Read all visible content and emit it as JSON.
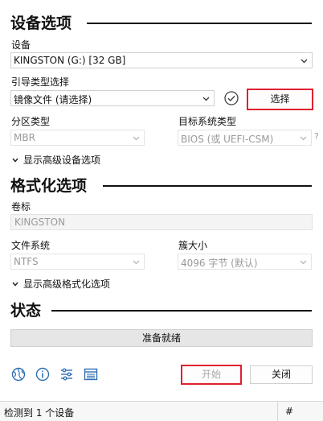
{
  "device_section": {
    "title": "设备选项",
    "device_label": "设备",
    "device_value": "KINGSTON (G:) [32 GB]",
    "boot_label": "引导类型选择",
    "boot_value": "镜像文件 (请选择)",
    "select_button": "选择",
    "partition_label": "分区类型",
    "partition_value": "MBR",
    "target_label": "目标系统类型",
    "target_value": "BIOS (或 UEFI-CSM)",
    "target_help": "?",
    "advanced_toggle": "显示高级设备选项"
  },
  "format_section": {
    "title": "格式化选项",
    "volume_label": "卷标",
    "volume_value": "KINGSTON",
    "fs_label": "文件系统",
    "fs_value": "NTFS",
    "cluster_label": "簇大小",
    "cluster_value": "4096 字节 (默认)",
    "advanced_toggle": "显示高级格式化选项"
  },
  "status_section": {
    "title": "状态",
    "progress_text": "准备就绪",
    "progress_fraction": 0
  },
  "toolbar": {
    "icons": [
      "globe-icon",
      "info-icon",
      "settings-sliders-icon",
      "log-icon"
    ]
  },
  "actions": {
    "start_button": "开始",
    "close_button": "关闭"
  },
  "statusbar": {
    "text": "检测到 1 个设备",
    "hash_symbol": "#"
  },
  "colors": {
    "highlight_red": "#e0202e",
    "icon_blue": "#2f6fb3"
  }
}
